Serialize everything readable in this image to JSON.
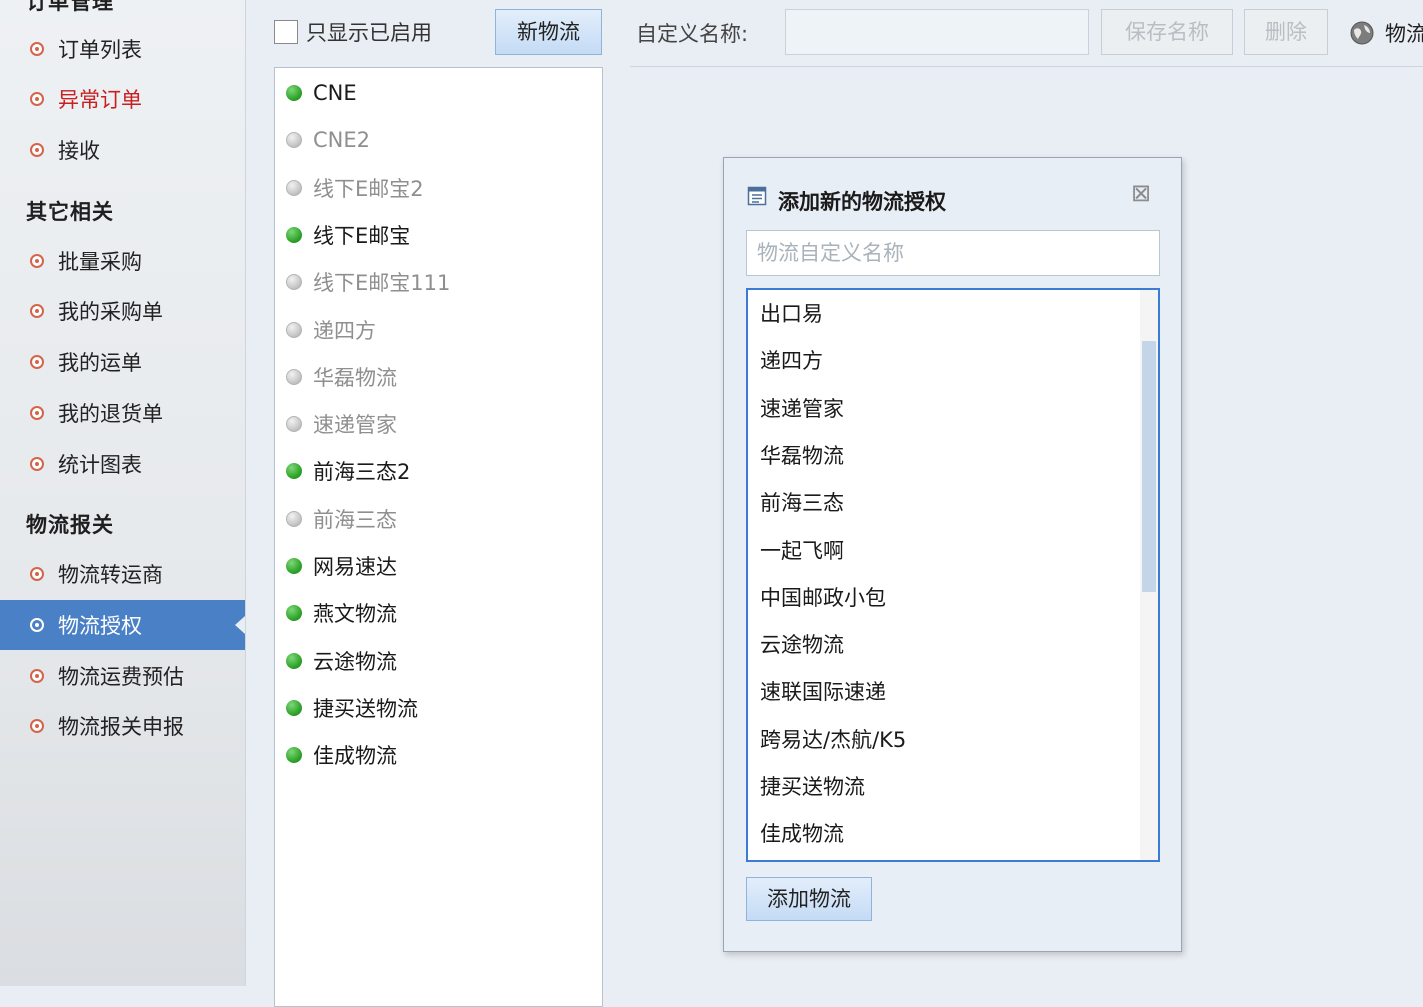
{
  "sidebar": {
    "sections": [
      {
        "header": "订单管理",
        "items": [
          {
            "label": "订单列表"
          },
          {
            "label": "异常订单"
          },
          {
            "label": "接收"
          }
        ]
      },
      {
        "header": "其它相关",
        "items": [
          {
            "label": "批量采购"
          },
          {
            "label": "我的采购单"
          },
          {
            "label": "我的运单"
          },
          {
            "label": "我的退货单"
          },
          {
            "label": "统计图表"
          }
        ]
      },
      {
        "header": "物流报关",
        "items": [
          {
            "label": "物流转运商"
          },
          {
            "label": "物流授权"
          },
          {
            "label": "物流运费预估"
          },
          {
            "label": "物流报关申报"
          }
        ]
      }
    ],
    "active_item": "物流授权",
    "highlighted_item": "异常订单"
  },
  "toolbar": {
    "show_enabled_label": "只显示已启用",
    "show_enabled_checked": false,
    "new_button": "新物流",
    "name_label": "自定义名称:",
    "name_value": "",
    "save_button": "保存名称",
    "delete_button": "删除",
    "right_label": "物流"
  },
  "carriers": [
    {
      "name": "CNE",
      "enabled": true
    },
    {
      "name": "CNE2",
      "enabled": false
    },
    {
      "name": "线下E邮宝2",
      "enabled": false
    },
    {
      "name": "线下E邮宝",
      "enabled": true
    },
    {
      "name": "线下E邮宝111",
      "enabled": false
    },
    {
      "name": "递四方",
      "enabled": false
    },
    {
      "name": "华磊物流",
      "enabled": false
    },
    {
      "name": "速递管家",
      "enabled": false
    },
    {
      "name": "前海三态2",
      "enabled": true
    },
    {
      "name": "前海三态",
      "enabled": false
    },
    {
      "name": "网易速达",
      "enabled": true
    },
    {
      "name": "燕文物流",
      "enabled": true
    },
    {
      "name": "云途物流",
      "enabled": true
    },
    {
      "name": "捷买送物流",
      "enabled": true
    },
    {
      "name": "佳成物流",
      "enabled": true
    }
  ],
  "dialog": {
    "title": "添加新的物流授权",
    "close_symbol": "⊠",
    "input_placeholder": "物流自定义名称",
    "options": [
      "出口易",
      "递四方",
      "速递管家",
      "华磊物流",
      "前海三态",
      "一起飞啊",
      "中国邮政小包",
      "云途物流",
      "速联国际速递",
      "跨易达/杰航/K5",
      "捷买送物流",
      "佳成物流"
    ],
    "scroll_position": 0.09,
    "scroll_visible_fraction": 0.44,
    "add_button": "添加物流"
  },
  "colors": {
    "accent": "#4a80c6",
    "enabled_dot": "#2fa52a",
    "disabled_dot": "#c9c9c9",
    "alert_text": "#c82020",
    "bullet": "#d4644a"
  }
}
